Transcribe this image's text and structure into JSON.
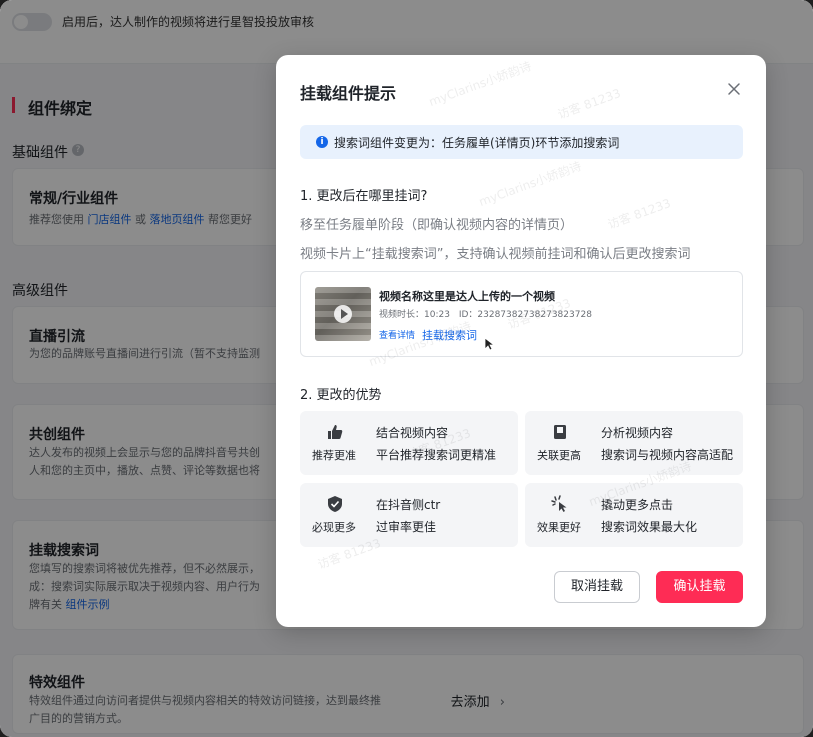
{
  "page": {
    "toggle_label": "启用后，达人制作的视频将进行星智投投放审核",
    "section_title": "组件绑定",
    "basic_title": "基础组件",
    "advanced_title": "高级组件",
    "cards": {
      "normal": {
        "title": "常规/行业组件",
        "desc_prefix": "推荐您使用",
        "link1": "门店组件",
        "or": "或",
        "link2": "落地页组件",
        "desc_suffix": "帮您更好"
      },
      "live": {
        "title": "直播引流",
        "desc": "为您的品牌账号直播间进行引流（暂不支持监测"
      },
      "cocreate": {
        "title": "共创组件",
        "desc1": "达人发布的视频上会显示与您的品牌抖音号共创",
        "desc2": "人和您的主页中，播放、点赞、评论等数据也将"
      },
      "search": {
        "title": "挂载搜索词",
        "desc1": "您填写的搜索词将被优先推荐，但不必然展示，",
        "desc2": "成：搜索词实际展示取决于视频内容、用户行为",
        "desc3": "牌有关",
        "link": "组件示例"
      },
      "effects": {
        "title": "特效组件",
        "desc1": "特效组件通过向访问者提供与视频内容相关的特效访问链接，达到最终推",
        "desc2": "广目的的营销方式。",
        "action": "去添加"
      }
    }
  },
  "modal": {
    "title": "挂载组件提示",
    "notice": "搜索词组件变更为：任务履单(详情页)环节添加搜索词",
    "q1": "1. 更改后在哪里挂词?",
    "q1_line1": "移至任务履单阶段（即确认视频内容的详情页）",
    "q1_line2": "视频卡片上“挂载搜索词”，支持确认视频前挂词和确认后更改搜索词",
    "video": {
      "name": "视频名称这里是达人上传的一个视频",
      "duration": "视频时长：10:23",
      "id": "ID：23287382738273823728",
      "detail_link": "查看详情",
      "mount_link": "挂载搜索词"
    },
    "q2": "2. 更改的优势",
    "advantages": [
      {
        "icon": "thumbs-up-icon",
        "name": "推荐更准",
        "line1": "结合视频内容",
        "line2": "平台推荐搜索词更精准"
      },
      {
        "icon": "book-icon",
        "name": "关联更高",
        "line1": "分析视频内容",
        "line2": "搜索词与视频内容高适配"
      },
      {
        "icon": "shield-check-icon",
        "name": "必现更多",
        "line1": "在抖音侧ctr",
        "line2": "过审率更佳"
      },
      {
        "icon": "sparkle-click-icon",
        "name": "效果更好",
        "line1": "撬动更多点击",
        "line2": "搜索词效果最大化"
      }
    ],
    "cancel_label": "取消挂载",
    "confirm_label": "确认挂载"
  },
  "watermark": {
    "user": "myClarins小娇韵诗",
    "visitor": "访客 81233"
  },
  "colors": {
    "accent": "#fe2c55",
    "link": "#1466e8",
    "notice_bg": "#e8f1fd"
  }
}
